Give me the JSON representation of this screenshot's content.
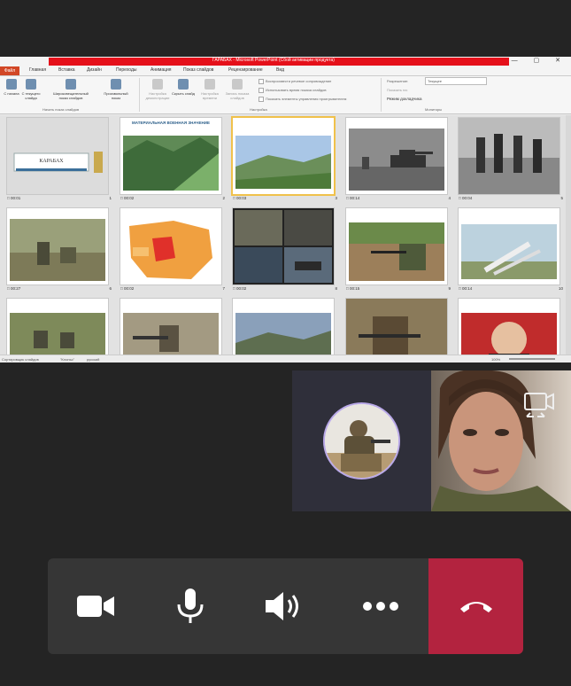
{
  "window": {
    "title": "ГАРАБАХ - Microsoft PowerPoint (Сбой активации продукта)",
    "controls": "— ▢ ✕"
  },
  "ribbon_tabs": [
    {
      "label": "Файл"
    },
    {
      "label": "Главная"
    },
    {
      "label": "Вставка"
    },
    {
      "label": "Дизайн"
    },
    {
      "label": "Переходы"
    },
    {
      "label": "Анимация"
    },
    {
      "label": "Показ слайдов"
    },
    {
      "label": "Рецензирование"
    },
    {
      "label": "Вид"
    }
  ],
  "ribbon": {
    "buttons": [
      {
        "label": "С начала"
      },
      {
        "label": "С текущего слайда"
      },
      {
        "label": "Широковещательный показ слайдов"
      },
      {
        "label": "Произвольный показ"
      },
      {
        "label": "Настройка демонстрации"
      },
      {
        "label": "Скрыть слайд"
      },
      {
        "label": "Настройка времени"
      },
      {
        "label": "Запись показа слайдов"
      }
    ],
    "checkboxes": [
      "Воспроизвести речевое сопровождение",
      "Использовать время показа слайдов",
      "Показать элементы управления проигрывателем"
    ],
    "monitor": {
      "resolution_label": "Разрешение:",
      "resolution_value": "Текущее",
      "show_on_label": "Показать на:",
      "presenter_view": "Режим докладчика"
    },
    "groups": [
      "Начать показ слайдов",
      "Настройка",
      "Мониторы"
    ]
  },
  "slides": [
    {
      "time": "00:01",
      "num": "1",
      "title": "КАРАБАХ"
    },
    {
      "time": "00:02",
      "num": "2",
      "title": "МАТЕРИАЛЬНАЯ ВОЕННАЯ ЗНАЧЕНИЕ"
    },
    {
      "time": "00:03",
      "num": "3",
      "title": ""
    },
    {
      "time": "00:14",
      "num": "4",
      "title": ""
    },
    {
      "time": "00:04",
      "num": "5",
      "title": ""
    },
    {
      "time": "00:27",
      "num": "6",
      "title": ""
    },
    {
      "time": "00:02",
      "num": "7",
      "title": ""
    },
    {
      "time": "00:02",
      "num": "8",
      "title": ""
    },
    {
      "time": "00:15",
      "num": "9",
      "title": ""
    },
    {
      "time": "00:14",
      "num": "10",
      "title": ""
    },
    {
      "time": "",
      "num": "",
      "title": ""
    },
    {
      "time": "",
      "num": "",
      "title": ""
    },
    {
      "time": "",
      "num": "",
      "title": ""
    },
    {
      "time": "",
      "num": "",
      "title": ""
    },
    {
      "time": "",
      "num": "",
      "title": ""
    }
  ],
  "status_bar": {
    "mode": "Сортировщик слайдов",
    "theme": "\"Клоньс\"",
    "language": "русский",
    "zoom": "100%"
  },
  "colors": {
    "end_call": "#b3233f",
    "callbar": "#363636",
    "background": "#242424"
  },
  "icons": [
    "camera-icon",
    "microphone-icon",
    "speaker-icon",
    "more-options-icon",
    "end-call-icon",
    "switch-camera-icon"
  ]
}
